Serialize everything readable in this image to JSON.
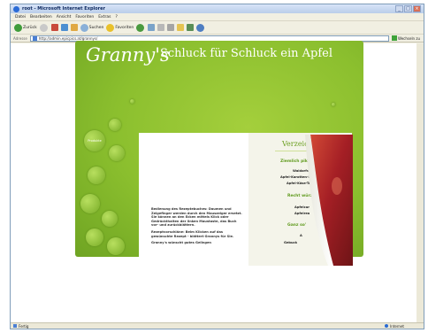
{
  "browser": {
    "title": "root - Microsoft Internet Explorer",
    "menu": [
      "Datei",
      "Bearbeiten",
      "Ansicht",
      "Favoriten",
      "Extras",
      "?"
    ],
    "toolbar": {
      "back_label": "Zurück",
      "search_label": "Suchen",
      "favorites_label": "Favoriten"
    },
    "address": {
      "label": "Adresse",
      "value": "http://admin.epicpics.at/grannys/",
      "go_label": "Wechseln zu"
    },
    "status": {
      "left": "Fertig",
      "right": "Internet"
    }
  },
  "site": {
    "logo": "Granny's",
    "slogan": "Schluck für Schluck ein Apfel",
    "nav": [
      "Produkte"
    ],
    "instructions": {
      "p1": "Bedienung des Rezeptebuches: Daumen und Zeigefinger werden durch den Mauszeiger ersetzt. Sie können an den Ecken mittels Klick oder Gedrückthalten der linken Maustaste, das Buch vor- und zurückblättern.",
      "p2": "Rezeptvorschläne: Beim Klicken auf das gewünschte Rezept - blättert Grannys für Sie.",
      "p3": "Granny's wünscht gutes Gelingen"
    },
    "index": {
      "heading": "Verzeichnis",
      "categories": [
        "Ziemlich pikant...",
        "Recht würz'",
        "Ganz so'"
      ],
      "pikant_items": [
        "Waldorfsalat",
        "Apfel-Karotten-Rohk",
        "Apfel-Käse-Toa"
      ],
      "wuerz_items": [
        "Apfelcur",
        "Apfelrea"
      ],
      "so_items": [
        "A",
        "Gebuck"
      ]
    },
    "colors": {
      "green": "#8bbf2e",
      "dark_green": "#6da024",
      "apple_red": "#b4282b"
    }
  }
}
